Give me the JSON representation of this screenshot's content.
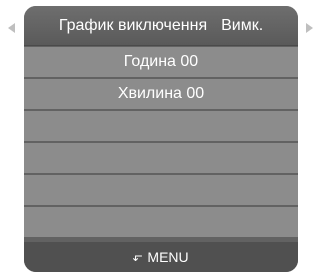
{
  "menu": {
    "title": "График виключення",
    "value": "Вимк.",
    "items": [
      {
        "label": "Година 00"
      },
      {
        "label": "Хвилина 00"
      },
      {
        "label": ""
      },
      {
        "label": ""
      },
      {
        "label": ""
      },
      {
        "label": ""
      }
    ],
    "footer_label": "MENU"
  },
  "icons": {
    "left": "chevron-left-icon",
    "right": "chevron-right-icon",
    "back": "return-arrow-icon"
  },
  "colors": {
    "panel": "#626262",
    "row": "#8c8c8c",
    "footer": "#505050",
    "text": "#ffffff",
    "arrow": "#bfbfbf"
  }
}
